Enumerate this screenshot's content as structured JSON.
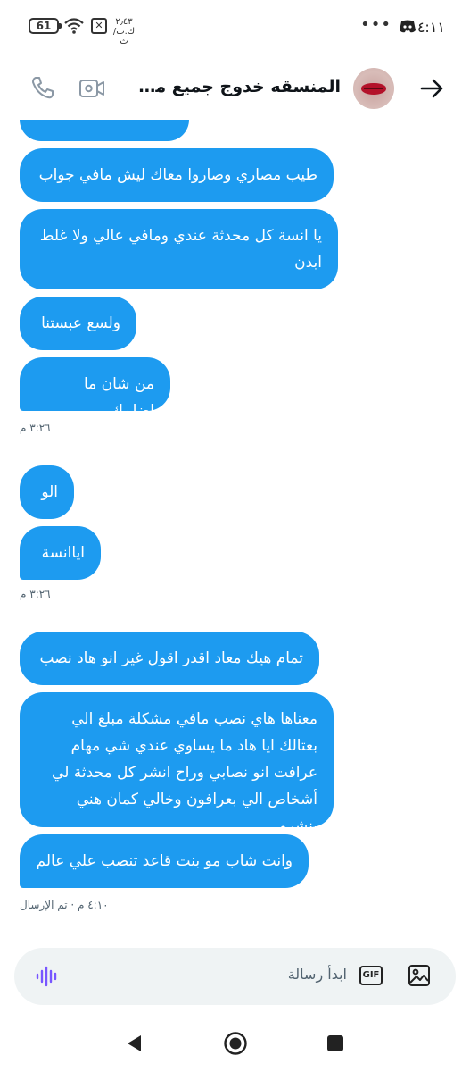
{
  "status_bar": {
    "time": "٤:١١",
    "dots": "•••",
    "battery": "61",
    "nosim": "✕",
    "speed_value": "٢٫٤٣",
    "speed_unit": "ك.ب/ث"
  },
  "header": {
    "title": "المنسقه خدوج جميع محافظ..."
  },
  "messages": [
    {
      "text": ""
    },
    {
      "text": "طيب مصاري وصاروا معاك ليش مافي جواب"
    },
    {
      "text": "يا انسة كل محدثة عندي  ومافي عالي ولا غلط ابدن"
    },
    {
      "text": "ولسع عبستنا"
    },
    {
      "text": "من شان ما اضلمك"
    },
    {
      "text": "الو"
    },
    {
      "text": "اياانسة"
    },
    {
      "text": "تمام هيك معاد اقدر اقول غير انو هاد نصب"
    },
    {
      "text": "معناها هاي نصب مافي مشكلة مبلغ الي بعتالك ايا هاد ما يساوي عندي شي مهام عرافت انو نصابي وراح انشر كل محدثة لي أشخاص الي بعرافون وخالي كمان هني ينشرو"
    },
    {
      "text": "وانت شاب مو بنت قاعد تنصب علي عالم"
    }
  ],
  "timestamps": [
    {
      "text": "٣:٢٦ م"
    },
    {
      "text": "٣:٢٦ م"
    },
    {
      "text": "٤:١٠ م · تم الإرسال"
    }
  ],
  "composer": {
    "placeholder": "ابدأ رسالة",
    "gif_label": "GIF"
  },
  "colors": {
    "bubble": "#1d9bf0",
    "composer_bg": "#eff3f4",
    "mic_accent": "#7856ff"
  }
}
